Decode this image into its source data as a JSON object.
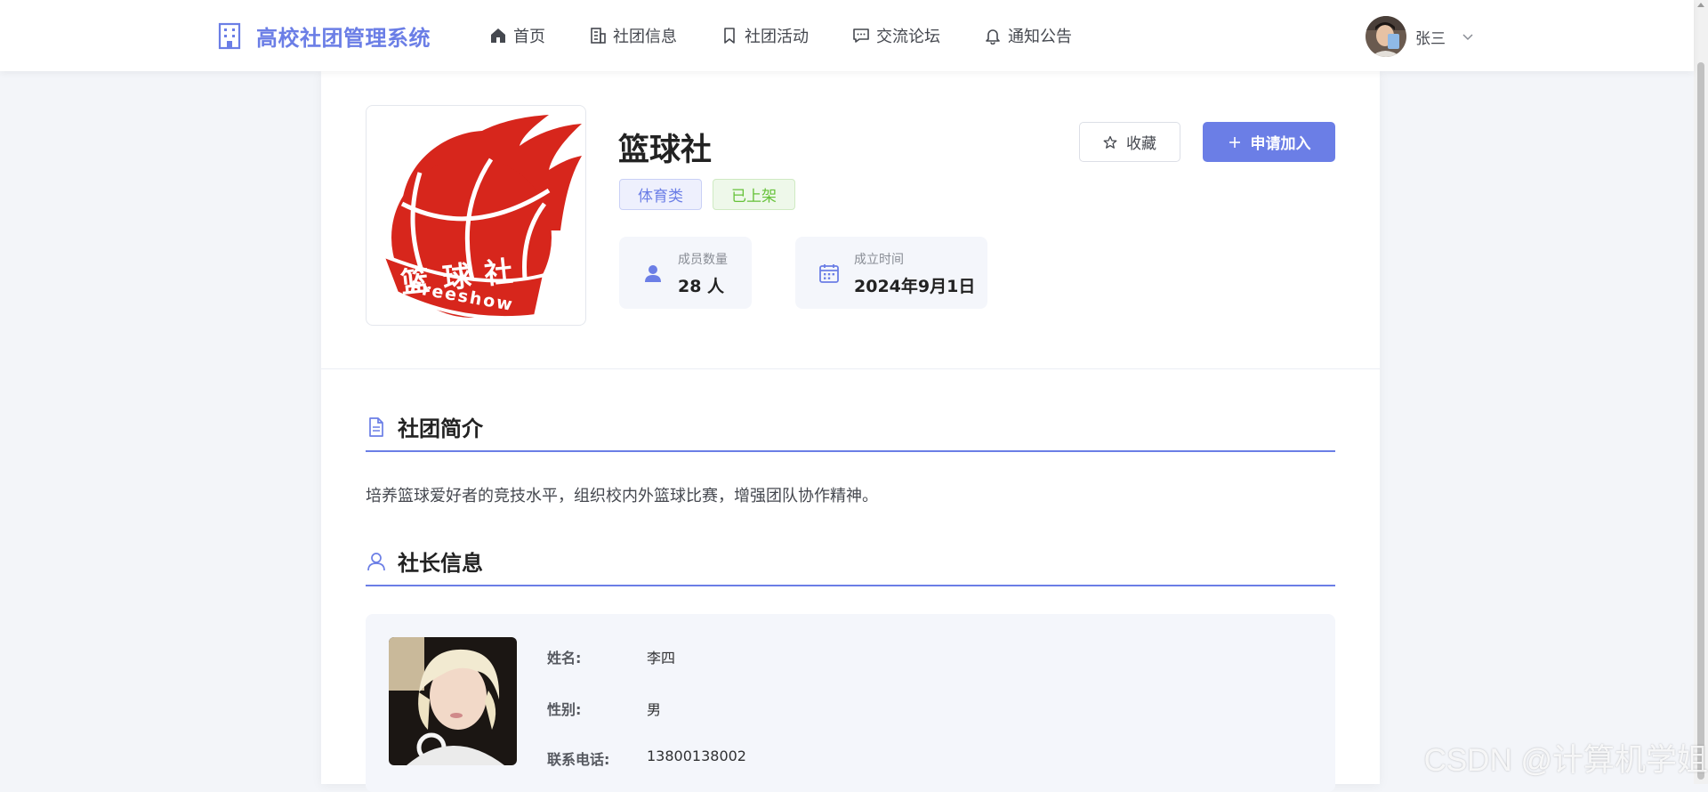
{
  "header": {
    "brand": "高校社团管理系统",
    "nav": [
      {
        "label": "首页",
        "icon": "home-icon"
      },
      {
        "label": "社团信息",
        "icon": "building-icon"
      },
      {
        "label": "社团活动",
        "icon": "bookmark-icon"
      },
      {
        "label": "交流论坛",
        "icon": "chat-icon"
      },
      {
        "label": "通知公告",
        "icon": "bell-icon"
      }
    ],
    "user": {
      "name": "张三"
    }
  },
  "club": {
    "name": "篮球社",
    "tags": [
      "体育类",
      "已上架"
    ],
    "stats": {
      "members_label": "成员数量",
      "members_value": "28 人",
      "founded_label": "成立时间",
      "founded_value": "2024年9月1日"
    },
    "actions": {
      "favorite": "收藏",
      "join": "申请加入"
    },
    "logo_text": "篮 球 社",
    "logo_subtext": "Freeshow"
  },
  "sections": {
    "intro": {
      "title": "社团简介",
      "text": "培养篮球爱好者的竞技水平，组织校内外篮球比赛，增强团队协作精神。"
    },
    "leader": {
      "title": "社长信息",
      "fields": [
        {
          "label": "姓名:",
          "value": "李四"
        },
        {
          "label": "性别:",
          "value": "男"
        },
        {
          "label": "联系电话:",
          "value": "13800138002"
        }
      ]
    }
  },
  "watermark": "CSDN @计算机学姐",
  "colors": {
    "accent": "#6b7ee6",
    "success": "#67c23a",
    "logo_red": "#d7261c"
  }
}
